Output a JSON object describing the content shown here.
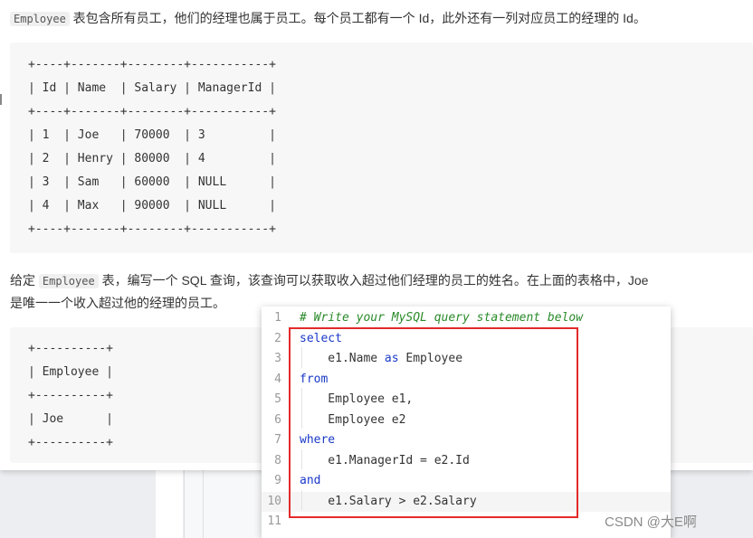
{
  "problem": {
    "intro_code": "Employee",
    "intro_text": " 表包含所有员工，他们的经理也属于员工。每个员工都有一个 Id，此外还有一列对应员工的经理的 Id。",
    "table_lines": [
      "+----+-------+--------+-----------+",
      "| Id | Name  | Salary | ManagerId |",
      "+----+-------+--------+-----------+",
      "| 1  | Joe   | 70000  | 3         |",
      "| 2  | Henry | 80000  | 4         |",
      "| 3  | Sam   | 60000  | NULL      |",
      "| 4  | Max   | 90000  | NULL      |",
      "+----+-------+--------+-----------+"
    ],
    "task_prefix": "给定 ",
    "task_code": "Employee",
    "task_text_line1": " 表，编写一个 SQL 查询，该查询可以获取收入超过他们经理的员工的姓名。在上面的表格中，Joe",
    "task_text_line2": "是唯一一个收入超过他的经理的员工。",
    "result_lines": [
      "+----------+",
      "| Employee |",
      "+----------+",
      "| Joe      |",
      "+----------+"
    ]
  },
  "editor": {
    "lines": [
      {
        "num": "1",
        "parts": [
          {
            "t": "# Write your MySQL query statement below",
            "c": "cm"
          }
        ]
      },
      {
        "num": "2",
        "parts": [
          {
            "t": "select",
            "c": "kw"
          }
        ]
      },
      {
        "num": "3",
        "parts": [
          {
            "t": "    e1.Name ",
            "c": ""
          },
          {
            "t": "as",
            "c": "kw"
          },
          {
            "t": " Employee",
            "c": ""
          }
        ]
      },
      {
        "num": "4",
        "parts": [
          {
            "t": "from",
            "c": "kw"
          }
        ]
      },
      {
        "num": "5",
        "parts": [
          {
            "t": "    Employee e1,",
            "c": ""
          }
        ]
      },
      {
        "num": "6",
        "parts": [
          {
            "t": "    Employee e2",
            "c": ""
          }
        ]
      },
      {
        "num": "7",
        "parts": [
          {
            "t": "where",
            "c": "kw"
          }
        ]
      },
      {
        "num": "8",
        "parts": [
          {
            "t": "    e1.ManagerId = e2.Id",
            "c": ""
          }
        ]
      },
      {
        "num": "9",
        "parts": [
          {
            "t": "and",
            "c": "kw"
          }
        ]
      },
      {
        "num": "10",
        "parts": [
          {
            "t": "    e1.Salary > e2.Salary",
            "c": ""
          }
        ]
      },
      {
        "num": "11",
        "parts": []
      }
    ],
    "active_line": "10",
    "keyword_color": "#1a39c8",
    "comment_color": "#2a8a2a",
    "highlight_color": "#e32a2a"
  },
  "watermark": "CSDN @大E啊"
}
